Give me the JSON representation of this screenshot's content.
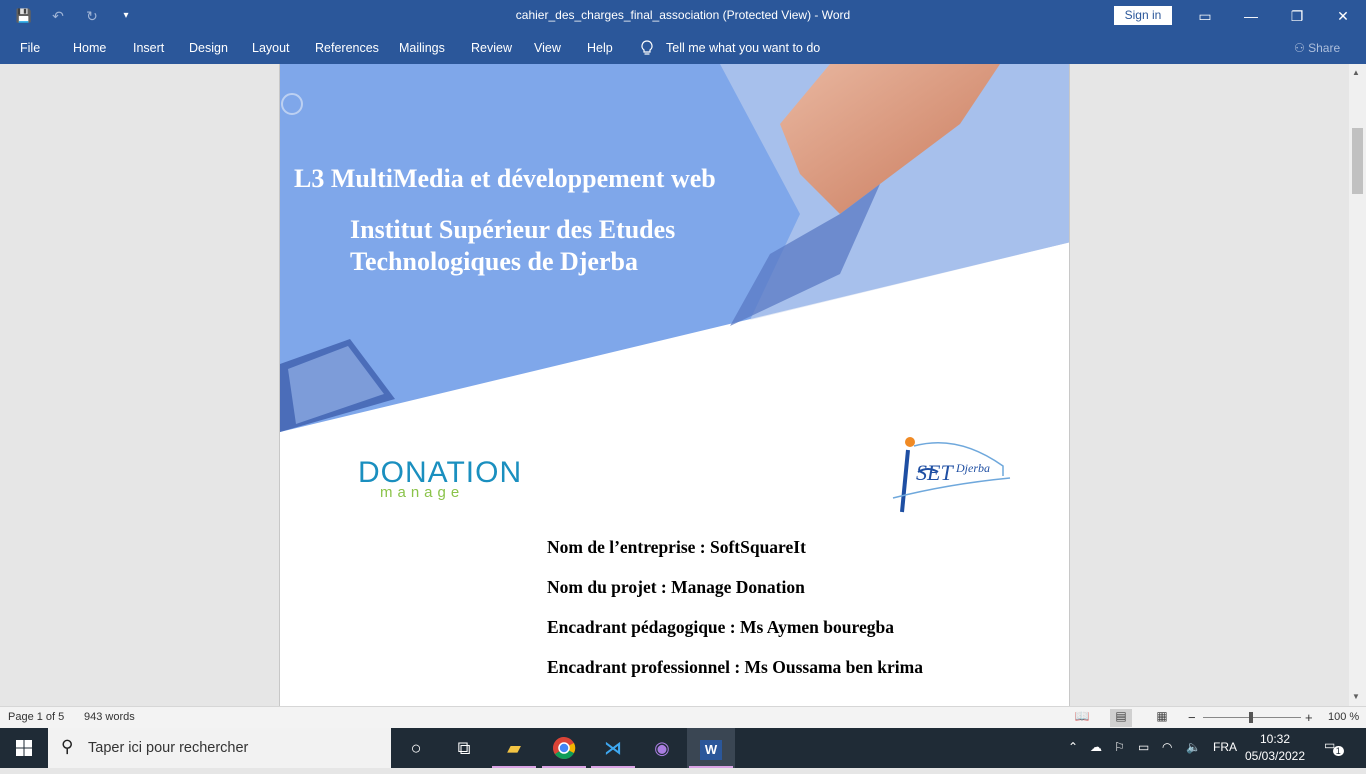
{
  "window": {
    "title": "cahier_des_charges_final_association (Protected View)  -  Word",
    "sign_in": "Sign in",
    "controls": {
      "ribbon_display": "▭",
      "minimize": "—",
      "restore": "❐",
      "close": "✕"
    }
  },
  "quick_access": {
    "save": "💾",
    "undo": "↶",
    "undo_menu": "▾",
    "redo": "↻",
    "customize": "▾"
  },
  "ribbon": {
    "tabs": [
      "File",
      "Home",
      "Insert",
      "Design",
      "Layout",
      "References",
      "Mailings",
      "Review",
      "View",
      "Help"
    ],
    "tell_me": "Tell me what you want to do",
    "tell_me_icon": "lightbulb-icon",
    "share": "Share"
  },
  "document": {
    "heading1": "L3 MultiMedia et développement web",
    "heading2_line1": "Institut Supérieur des Etudes",
    "heading2_line2": "Technologiques de Djerba",
    "logo_donation_main": "DONATION",
    "logo_donation_sub": "manage",
    "logo_iset": "ISET Djerba",
    "info": [
      "Nom de l’entreprise : SoftSquareIt",
      "Nom du projet : Manage Donation",
      "Encadrant pédagogique : Ms Aymen bouregba",
      "Encadrant professionnel : Ms Oussama ben krima"
    ],
    "colors": {
      "hero_blue": "#7fa7ea",
      "logo_blue": "#1a8fbf",
      "logo_green": "#8bc34a"
    }
  },
  "status_bar": {
    "page": "Page 1 of 5",
    "words": "943 words",
    "zoom_minus": "−",
    "zoom_plus": "+",
    "zoom": "100 %"
  },
  "taskbar": {
    "search_placeholder": "Taper ici pour rechercher",
    "language": "FRA",
    "time": "10:32",
    "date": "05/03/2022",
    "notification_count": "1"
  }
}
